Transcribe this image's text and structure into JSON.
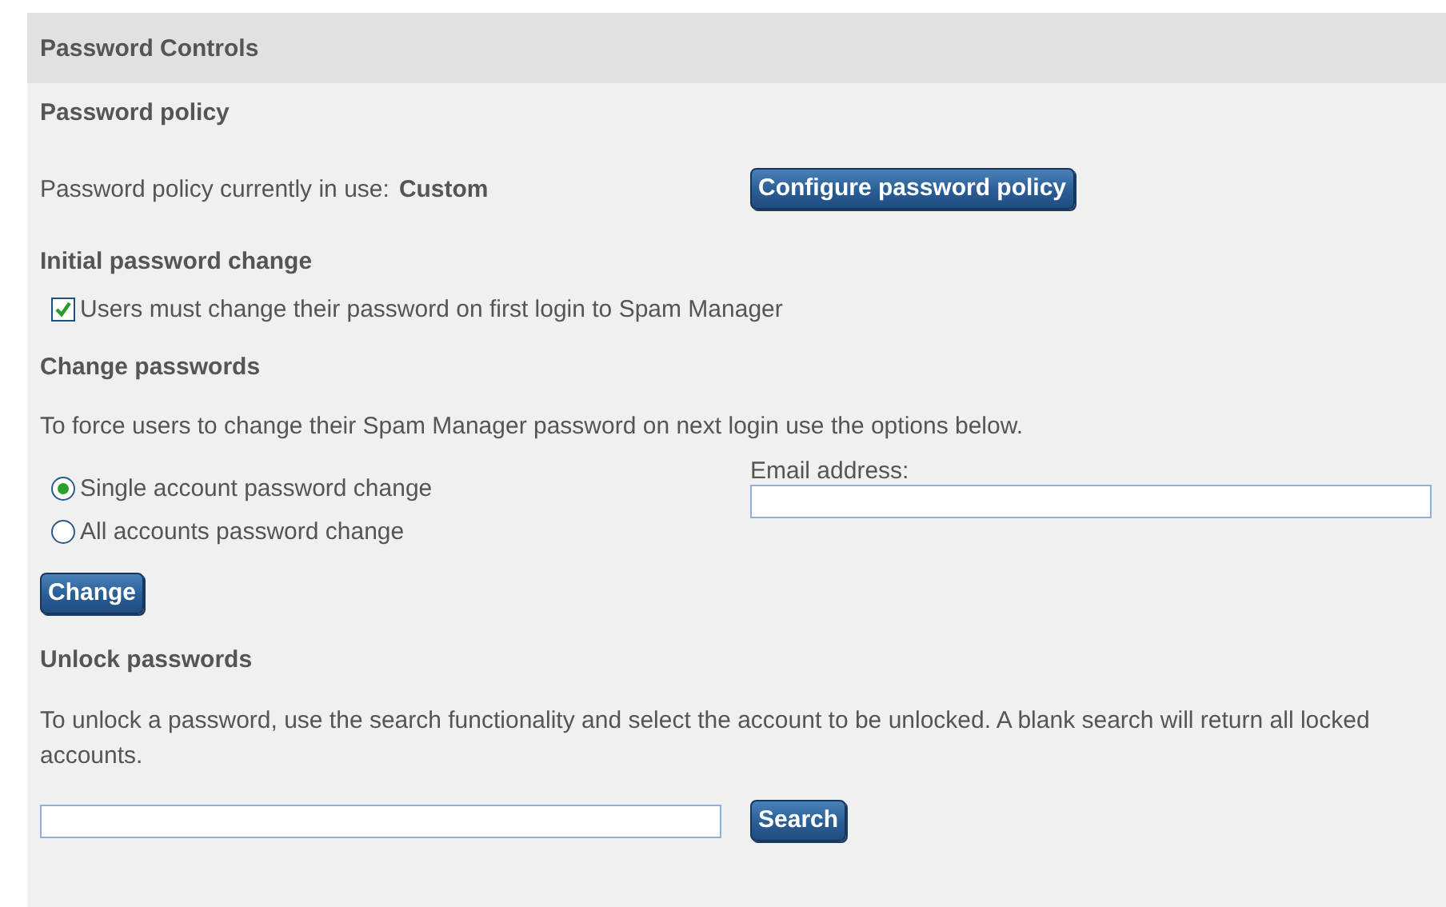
{
  "panel": {
    "title": "Password Controls"
  },
  "password_policy": {
    "heading": "Password policy",
    "label": "Password policy currently in use:",
    "value": "Custom",
    "button": "Configure password policy"
  },
  "initial_change": {
    "heading": "Initial password change",
    "checkbox": {
      "label": "Users must change their password on first login to Spam Manager",
      "checked": true
    }
  },
  "change_passwords": {
    "heading": "Change passwords",
    "description": "To force users to change their Spam Manager password on next login use the options below.",
    "options": [
      {
        "label": "Single account password change",
        "selected": true
      },
      {
        "label": "All accounts password change",
        "selected": false
      }
    ],
    "email_field": {
      "label": "Email address:"
    },
    "button": "Change"
  },
  "unlock": {
    "heading": "Unlock passwords",
    "description": "To unlock a password, use the search functionality and select the account to be unlocked. A blank search will return all locked accounts.",
    "button": "Search"
  }
}
